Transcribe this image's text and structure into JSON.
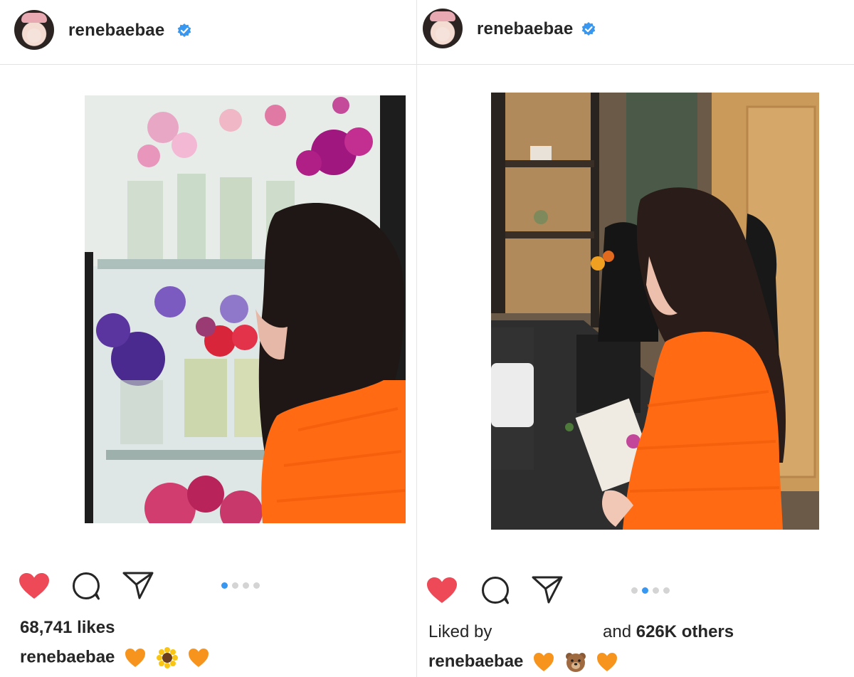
{
  "posts": [
    {
      "username": "renebaebae",
      "verified": true,
      "likes_text": "68,741 likes",
      "caption_user": "renebaebae",
      "caption_emojis": [
        "orange-heart",
        "sunflower",
        "orange-heart"
      ],
      "carousel": {
        "count": 4,
        "active": 1
      }
    },
    {
      "username": "renebaebae",
      "verified": true,
      "liked_by_prefix": "Liked by",
      "liked_by_suffix": "and",
      "liked_by_count": "626K others",
      "caption_user": "renebaebae",
      "caption_emojis": [
        "orange-heart",
        "bear-face",
        "orange-heart"
      ],
      "carousel": {
        "count": 4,
        "active": 2
      }
    }
  ],
  "colors": {
    "like_red": "#ed4956",
    "verified_blue": "#3897f0",
    "dot_active": "#3897f0",
    "dot_inactive": "#d4d4d4",
    "sweater_orange": "#ff6a13"
  }
}
